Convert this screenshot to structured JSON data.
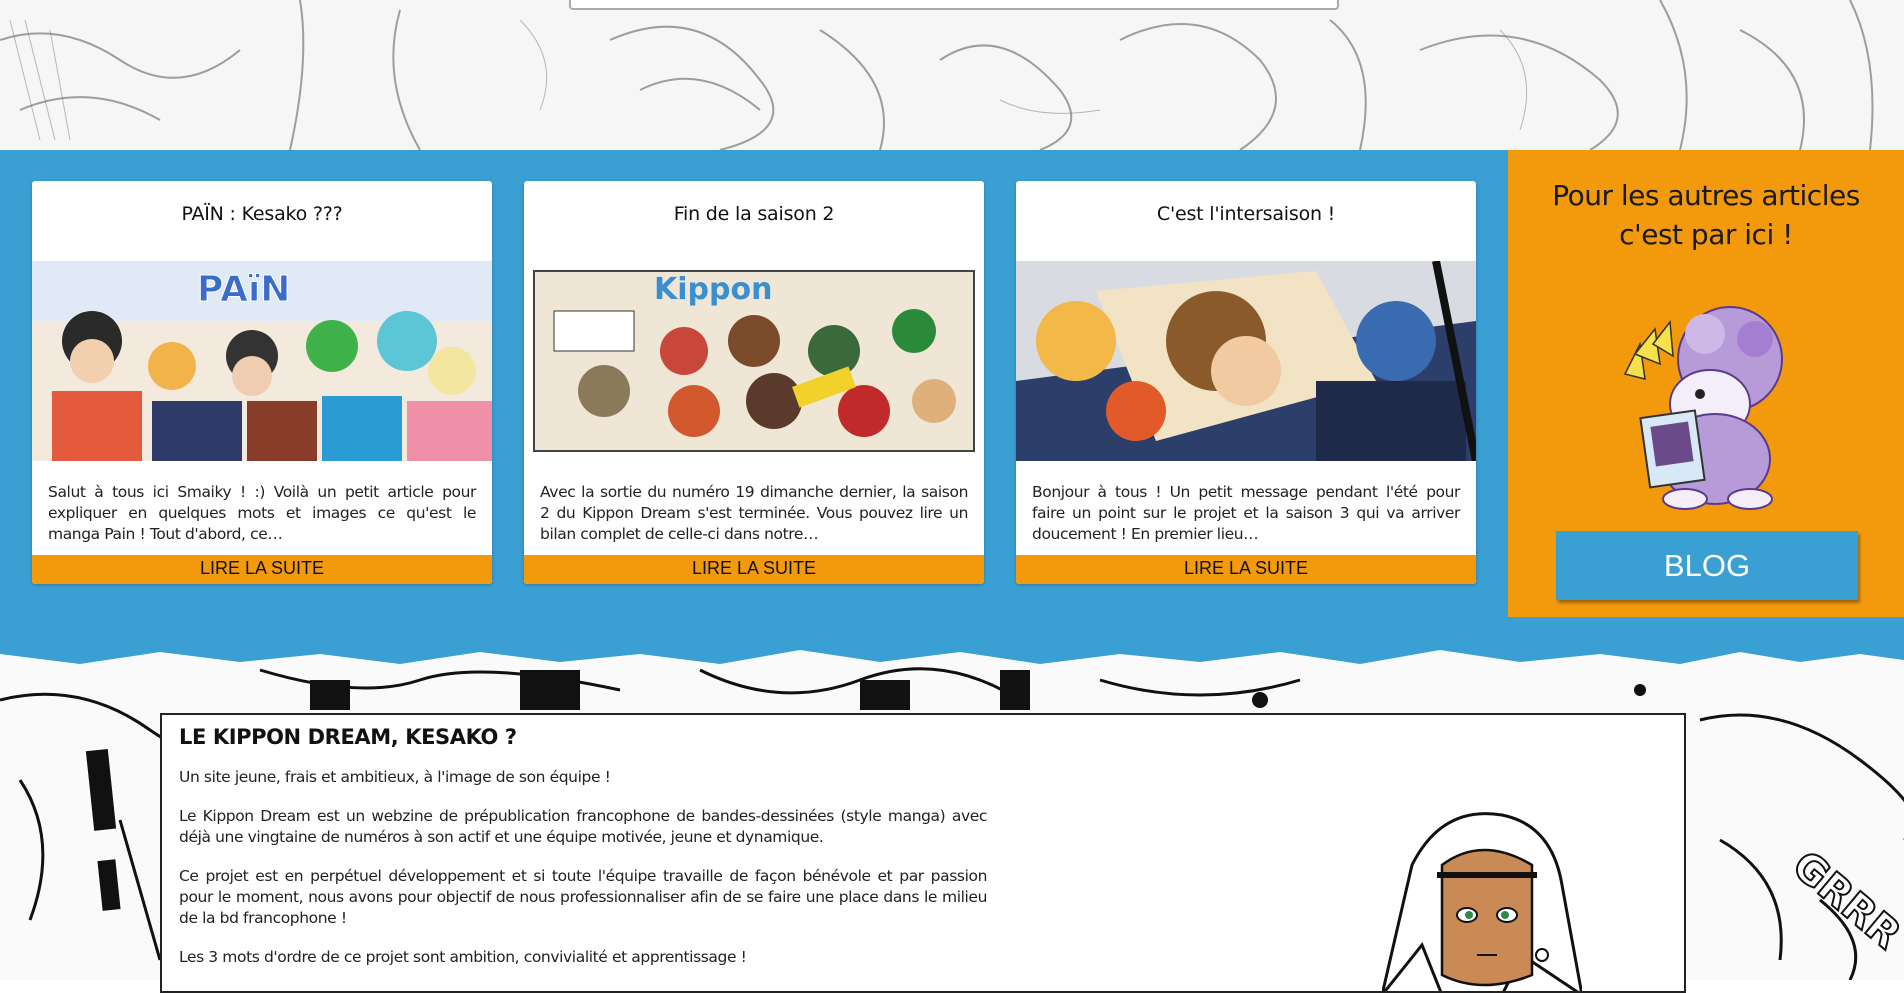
{
  "articles": [
    {
      "title": "PAÏN : Kesako ???",
      "excerpt": "Salut à tous ici Smaiky ! :) Voilà un petit article pour expliquer en quelques mots et images ce qu'est le manga Pain ! Tout d'abord, ce…",
      "button": "LIRE LA SUITE",
      "image_alt": "pain-cover-art"
    },
    {
      "title": "Fin de la saison 2",
      "excerpt": "Avec la sortie du numéro 19 dimanche dernier, la saison 2 du Kippon Dream s'est terminée. Vous pouvez lire un bilan complet de celle-ci dans notre…",
      "button": "LIRE LA SUITE",
      "image_alt": "kippon-dream-season-2-collage"
    },
    {
      "title": "C'est l'intersaison !",
      "excerpt": "Bonjour à tous ! Un petit message pendant l'été pour faire un point sur le projet et la saison 3 qui va arriver doucement ! En premier lieu…",
      "button": "LIRE LA SUITE",
      "image_alt": "manga-poster-photo"
    }
  ],
  "blog_panel": {
    "title": "Pour les autres articles c'est par ici !",
    "button": "BLOG",
    "mascot_icon": "purple-mascot-reading-icon"
  },
  "about": {
    "title": "LE KIPPON DREAM, KESAKO ?",
    "paragraphs": [
      "Un site jeune, frais et ambitieux, à l'image de son équipe !",
      "Le Kippon Dream est un webzine de prépublication francophone de bandes-dessinées (style manga) avec déjà une vingtaine de numéros à son actif et une équipe motivée, jeune et dynamique.",
      "Ce projet est en perpétuel développement et si toute l'équipe travaille de façon bénévole et par passion pour le moment, nous avons pour objectif de nous professionnaliser afin de se faire une place dans le milieu de la bd francophone !",
      "Les 3 mots d'ordre de ce projet sont ambition, convivialité et apprentissage !"
    ],
    "character_icon": "white-haired-character-icon"
  },
  "colors": {
    "blue": "#3a9fd3",
    "orange": "#f39a0c"
  }
}
